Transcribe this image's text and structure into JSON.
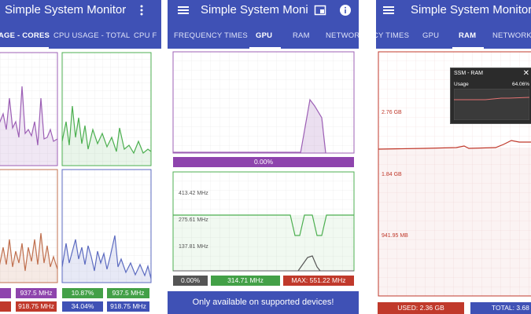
{
  "app": {
    "title_left": "Simple System Monitor",
    "title_mid": "Simple System Moni",
    "title_right": "Simple System Monitor"
  },
  "screen1": {
    "tabs": [
      "AGE - CORES",
      "CPU USAGE - TOTAL",
      "CPU F"
    ],
    "active_tab": 0,
    "stats_row1": [
      "",
      "937.5 MHz",
      "10.87%",
      "937.5 MHz"
    ],
    "stats_row2": [
      "",
      "918.75 MHz",
      "34.04%",
      "918.75 MHz"
    ],
    "colors": {
      "core1": "#9c5fb5",
      "core2": "#4caf50",
      "core3": "#c0704f",
      "core4": "#5c6bc0"
    }
  },
  "screen2": {
    "tabs": [
      "FREQUENCY TIMES",
      "GPU",
      "RAM",
      "NETWORK"
    ],
    "active_tab": 1,
    "usage_bar": "0.00%",
    "freq_labels": [
      "413.42 MHz",
      "275.61 MHz",
      "137.81 MHz"
    ],
    "stats": [
      "0.00%",
      "314.71 MHz",
      "MAX: 551.22 MHz"
    ],
    "banner": "Only available on supported devices!"
  },
  "screen3": {
    "tabs": [
      "CY TIMES",
      "GPU",
      "RAM",
      "NETWORK"
    ],
    "active_tab": 2,
    "y_labels": [
      "2.76 GB",
      "1.84 GB",
      "941.95 MB"
    ],
    "overlay": {
      "title": "SSM - RAM",
      "close": "✕",
      "usage_label": "Usage",
      "usage_value": "64.06%"
    },
    "used": "USED: 2.36 GB",
    "total": "TOTAL: 3.68 G"
  }
}
